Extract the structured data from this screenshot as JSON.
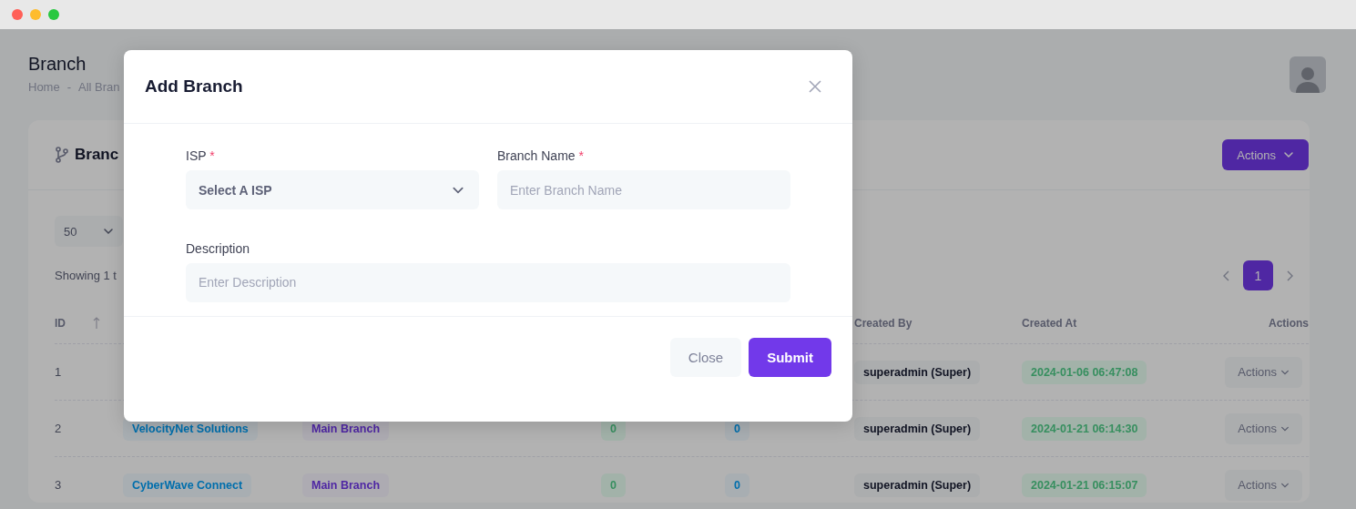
{
  "page": {
    "title": "Branch",
    "breadcrumb": [
      "Home",
      "-",
      "All Bran"
    ]
  },
  "card": {
    "title": "Branc",
    "actions_label": "Actions",
    "page_size": "50",
    "showing": "Showing 1 t",
    "pages": [
      {
        "label": "1",
        "selected": true
      }
    ]
  },
  "table": {
    "columns": [
      {
        "label": "ID",
        "sortable": true
      },
      {},
      {},
      {},
      {},
      {
        "label": "Created By"
      },
      {
        "label": "Created At"
      },
      {
        "label": "Actions"
      }
    ],
    "rows": [
      {
        "id": "1",
        "created_by": "superadmin (Super)",
        "created_at": "2024-01-06 06:47:08",
        "action": "Actions"
      },
      {
        "id": "2",
        "isp": "VelocityNet Solutions",
        "branch": "Main Branch",
        "count_1": "0",
        "count_2": "0",
        "created_by": "superadmin (Super)",
        "created_at": "2024-01-21 06:14:30",
        "action": "Actions"
      },
      {
        "id": "3",
        "isp": "CyberWave Connect",
        "branch": "Main Branch",
        "count_1": "0",
        "count_2": "0",
        "created_by": "superadmin (Super)",
        "created_at": "2024-01-21 06:15:07",
        "action": "Actions"
      }
    ]
  },
  "modal": {
    "title": "Add Branch",
    "fields": [
      {
        "kind": "select",
        "label": "ISP",
        "required_mark": "*",
        "value": "Select A ISP"
      },
      {
        "kind": "input",
        "label": "Branch Name",
        "required_mark": "*",
        "placeholder": "Enter Branch Name"
      },
      {
        "kind": "input",
        "label": "Description",
        "placeholder": "Enter Description",
        "wide": true
      }
    ],
    "buttons": [
      {
        "kind": "secondary",
        "label": "Close"
      },
      {
        "kind": "primary",
        "label": "Submit"
      }
    ]
  }
}
